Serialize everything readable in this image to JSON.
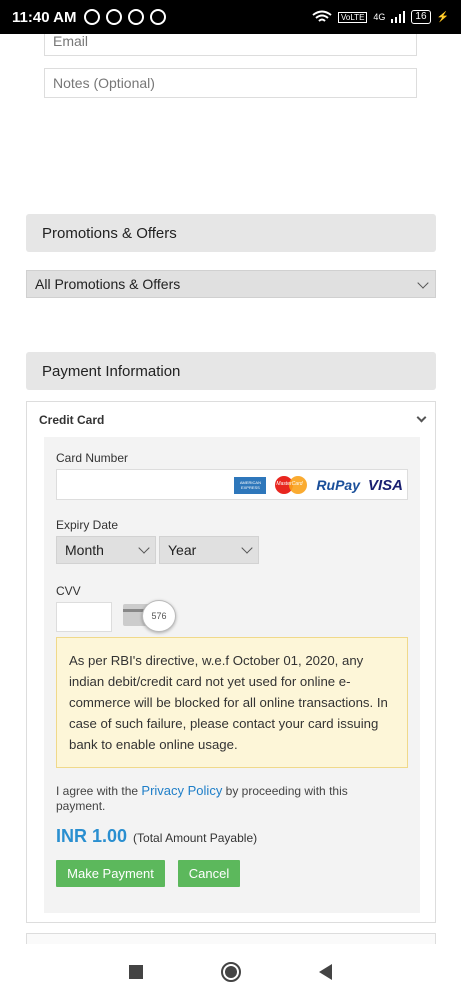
{
  "status_bar": {
    "time": "11:40 AM",
    "network": "4G",
    "battery": "16"
  },
  "contact": {
    "email_placeholder": "Email",
    "notes_placeholder": "Notes (Optional)"
  },
  "promotions": {
    "heading": "Promotions & Offers",
    "selected": "All Promotions & Offers"
  },
  "payment": {
    "heading": "Payment Information",
    "method_title": "Credit Card",
    "card_number_label": "Card Number",
    "card_brands": [
      "AMERICAN EXPRESS",
      "MasterCard",
      "RuPay",
      "VISA"
    ],
    "expiry_label": "Expiry Date",
    "month_selected": "Month",
    "year_selected": "Year",
    "cvv_label": "CVV",
    "cvv_hint": "576",
    "notice": "As per RBI's directive, w.e.f October 01, 2020, any indian debit/credit card not yet used for online e-commerce will be blocked for all online transactions. In case of such failure, please contact your card issuing bank to enable online usage.",
    "agree_prefix": "I agree with the",
    "privacy_link": "Privacy Policy",
    "agree_suffix": "by proceeding with this payment.",
    "amount": "INR 1.00",
    "amount_note": "(Total Amount Payable)",
    "make_payment": "Make Payment",
    "cancel": "Cancel"
  }
}
